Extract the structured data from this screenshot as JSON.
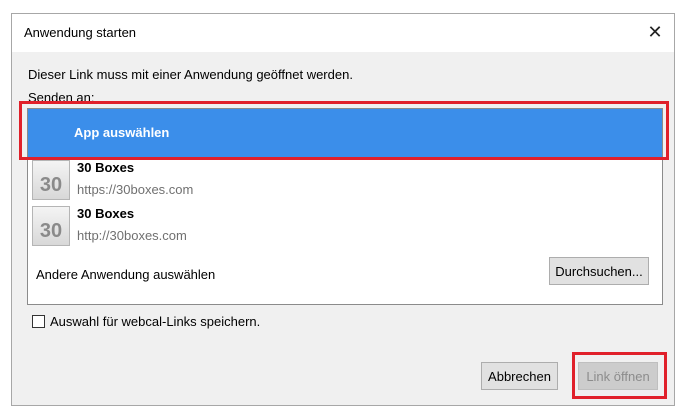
{
  "dialog": {
    "title": "Anwendung starten",
    "close_glyph": "✕",
    "message": "Dieser Link muss mit einer Anwendung geöffnet werden.",
    "send_to_label": "Senden an:"
  },
  "app_list": {
    "selected_item": "App auswählen",
    "apps": [
      {
        "name": "30 Boxes",
        "url": "https://30boxes.com",
        "icon_text": "30"
      },
      {
        "name": "30 Boxes",
        "url": "http://30boxes.com",
        "icon_text": "30"
      }
    ],
    "other_app_label": "Andere Anwendung auswählen",
    "browse_button_label": "Durchsuchen..."
  },
  "remember_choice": {
    "label": "Auswahl für webcal-Links speichern.",
    "checked": false
  },
  "footer": {
    "cancel_label": "Abbrechen",
    "open_link_label": "Link öffnen"
  },
  "colors": {
    "selection": "#3b8eea",
    "highlight": "#e0202a"
  }
}
